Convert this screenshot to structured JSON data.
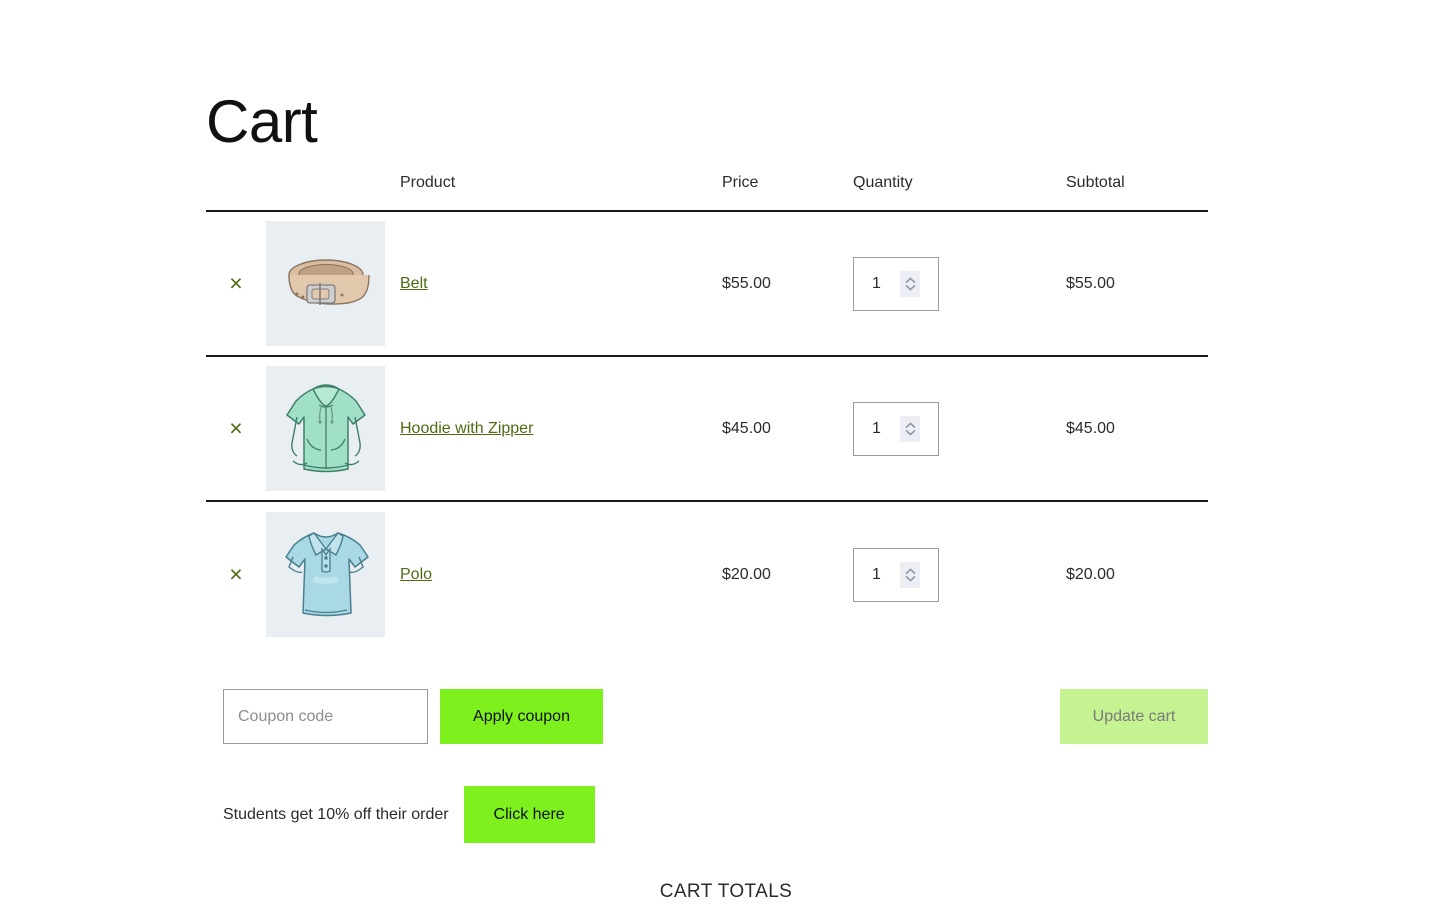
{
  "page": {
    "title": "Cart",
    "totals_heading": "CART TOTALS"
  },
  "table": {
    "headers": {
      "remove": "",
      "thumbnail": "",
      "product": "Product",
      "price": "Price",
      "quantity": "Quantity",
      "subtotal": "Subtotal"
    },
    "remove_label": "×",
    "rows": [
      {
        "remove_icon": "remove-item-icon",
        "thumb_icon": "belt-thumbnail",
        "name": "Belt",
        "price": "$55.00",
        "quantity": "1",
        "subtotal": "$55.00"
      },
      {
        "remove_icon": "remove-item-icon",
        "thumb_icon": "hoodie-thumbnail",
        "name": "Hoodie with Zipper",
        "price": "$45.00",
        "quantity": "1",
        "subtotal": "$45.00"
      },
      {
        "remove_icon": "remove-item-icon",
        "thumb_icon": "polo-thumbnail",
        "name": "Polo",
        "price": "$20.00",
        "quantity": "1",
        "subtotal": "$20.00"
      }
    ]
  },
  "coupon": {
    "placeholder": "Coupon code",
    "value": "",
    "apply_label": "Apply coupon",
    "update_cart_label": "Update cart"
  },
  "promo": {
    "text": "Students get 10% off their order",
    "button_label": "Click here"
  },
  "colors": {
    "accent_green": "#7ef01e",
    "accent_green_disabled": "#c6f391",
    "link_green": "#4e6b12",
    "thumb_bg": "#e8eef2",
    "rule": "#1a1a1a"
  }
}
